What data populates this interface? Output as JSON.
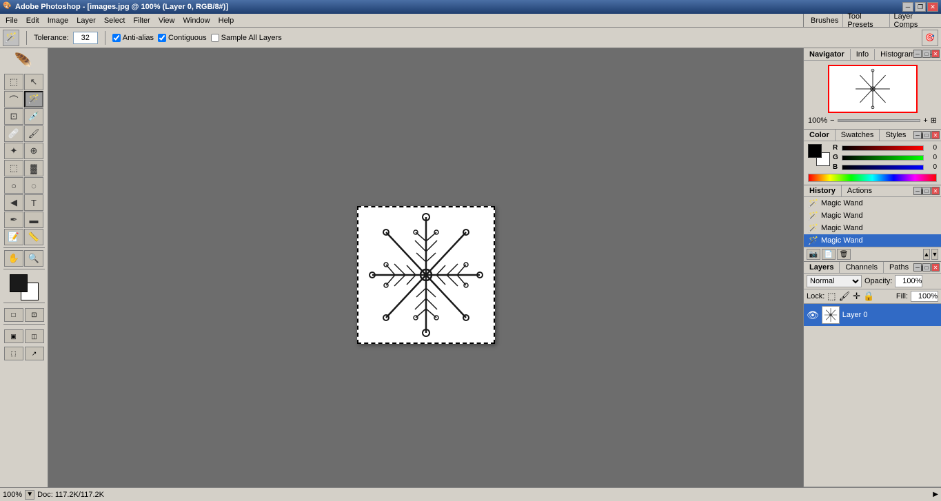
{
  "title_bar": {
    "text": "Adobe Photoshop - [images.jpg @ 100% (Layer 0, RGB/8#)]",
    "minimize": "─",
    "maximize": "□",
    "close": "✕",
    "restore": "❐"
  },
  "menu": {
    "items": [
      "File",
      "Edit",
      "Image",
      "Layer",
      "Select",
      "Filter",
      "View",
      "Window",
      "Help"
    ]
  },
  "options_bar": {
    "tool_icon": "🪄",
    "tolerance_label": "Tolerance:",
    "tolerance_value": "32",
    "anti_alias_label": "Anti-alias",
    "anti_alias_checked": true,
    "contiguous_label": "Contiguous",
    "contiguous_checked": true,
    "sample_all_label": "Sample All Layers",
    "sample_all_checked": false
  },
  "toolbox": {
    "tools": [
      [
        "▭",
        "↖"
      ],
      [
        "⊕",
        "↔"
      ],
      [
        "⌒",
        "✂"
      ],
      [
        "✂",
        "⌒"
      ],
      [
        "✎",
        "✏"
      ],
      [
        "⊗",
        "✒"
      ],
      [
        "▒",
        "▓"
      ],
      [
        "◌",
        "✦"
      ],
      [
        "✍",
        "T"
      ],
      [
        "◀",
        "🔡"
      ],
      [
        "⊡",
        "▬"
      ],
      [
        "☞",
        "💊"
      ],
      [
        "🔍",
        "🔍"
      ]
    ]
  },
  "navigator": {
    "tab_label": "Navigator",
    "tab2_label": "Info",
    "tab3_label": "Histogram",
    "zoom_value": "100%"
  },
  "color_panel": {
    "tab_label": "Color",
    "tab2_label": "Swatches",
    "tab3_label": "Styles",
    "r_label": "R",
    "g_label": "G",
    "b_label": "B",
    "r_value": "0",
    "g_value": "0",
    "b_value": "0"
  },
  "history_panel": {
    "tab_label": "History",
    "tab2_label": "Actions",
    "items": [
      {
        "label": "Magic Wand",
        "active": false
      },
      {
        "label": "Magic Wand",
        "active": false
      },
      {
        "label": "Magic Wand",
        "active": false
      },
      {
        "label": "Magic Wand",
        "active": true
      }
    ]
  },
  "layers_panel": {
    "tab_label": "Layers",
    "tab2_label": "Channels",
    "tab3_label": "Paths",
    "blend_mode": "Normal",
    "opacity_label": "Opacity:",
    "opacity_value": "100%",
    "lock_label": "Lock:",
    "fill_label": "Fill:",
    "fill_value": "100%",
    "layer_name": "Layer 0"
  },
  "status_bar": {
    "zoom": "100%",
    "doc_info": "Doc: 117.2K/117.2K"
  },
  "panel_tabs": {
    "brushes": "Brushes",
    "tool_presets": "Tool Presets",
    "layer_comps": "Layer Comps"
  }
}
